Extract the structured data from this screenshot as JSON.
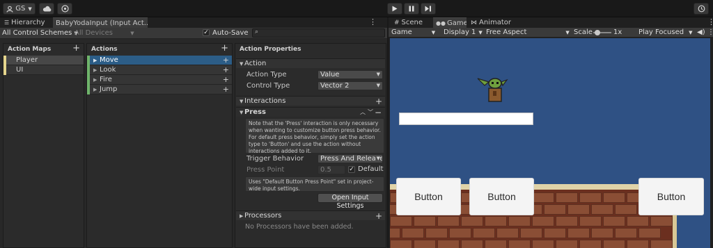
{
  "toolbar": {
    "account_label": "GS",
    "account_icon": "caret-down-icon",
    "cloud_icon": "cloud-icon",
    "collab_icon": "collab-icon",
    "play_icon": "play-icon",
    "pause_icon": "pause-icon",
    "step_icon": "step-icon",
    "history_icon": "history-icon"
  },
  "left_tabs": {
    "hierarchy": "Hierarchy",
    "input_actions": "BabyYodaInput (Input Act..."
  },
  "right_tabs": {
    "scene": "Scene",
    "game": "Game",
    "animator": "Animator"
  },
  "input_editor": {
    "control_schemes": "All Control Schemes",
    "devices": "All Devices",
    "auto_save": "Auto-Save",
    "auto_save_checked": true,
    "search_placeholder": "",
    "action_maps_header": "Action Maps",
    "action_maps": [
      {
        "label": "Player",
        "color": "#e5d58c",
        "selected": true
      },
      {
        "label": "UI",
        "color": "#e5d58c",
        "selected": false
      }
    ],
    "actions_header": "Actions",
    "actions": [
      {
        "label": "Move",
        "color": "#6fb46b",
        "selected": true
      },
      {
        "label": "Look",
        "color": "#6fb46b",
        "selected": false
      },
      {
        "label": "Fire",
        "color": "#6fb46b",
        "selected": false
      },
      {
        "label": "Jump",
        "color": "#6fb46b",
        "selected": false
      }
    ],
    "properties_header": "Action Properties",
    "action_section": "Action",
    "action_type_label": "Action Type",
    "action_type_value": "Value",
    "control_type_label": "Control Type",
    "control_type_value": "Vector 2",
    "interactions_section": "Interactions",
    "press_section": "Press",
    "press_help": "Note that the 'Press' interaction is only necessary when wanting to customize button press behavior. For default press behavior, simply set the action type to 'Button' and use the action without interactions added to it.",
    "trigger_behavior_label": "Trigger Behavior",
    "trigger_behavior_value": "Press And Release",
    "press_point_label": "Press Point",
    "press_point_value": "0.5",
    "default_label": "Default",
    "default_checked": true,
    "press_point_help": "Uses \"Default Button Press Point\" set in project-wide input settings.",
    "open_input_settings": "Open Input Settings",
    "processors_section": "Processors",
    "no_processors": "No Processors have been added."
  },
  "game_view": {
    "mode": "Game",
    "display": "Display 1",
    "aspect": "Free Aspect",
    "scale_label": "Scale",
    "scale_value": "1x",
    "play_focused": "Play Focused",
    "sky_color": "#2f5184",
    "buttons": [
      "Button",
      "Button",
      "Button"
    ]
  }
}
